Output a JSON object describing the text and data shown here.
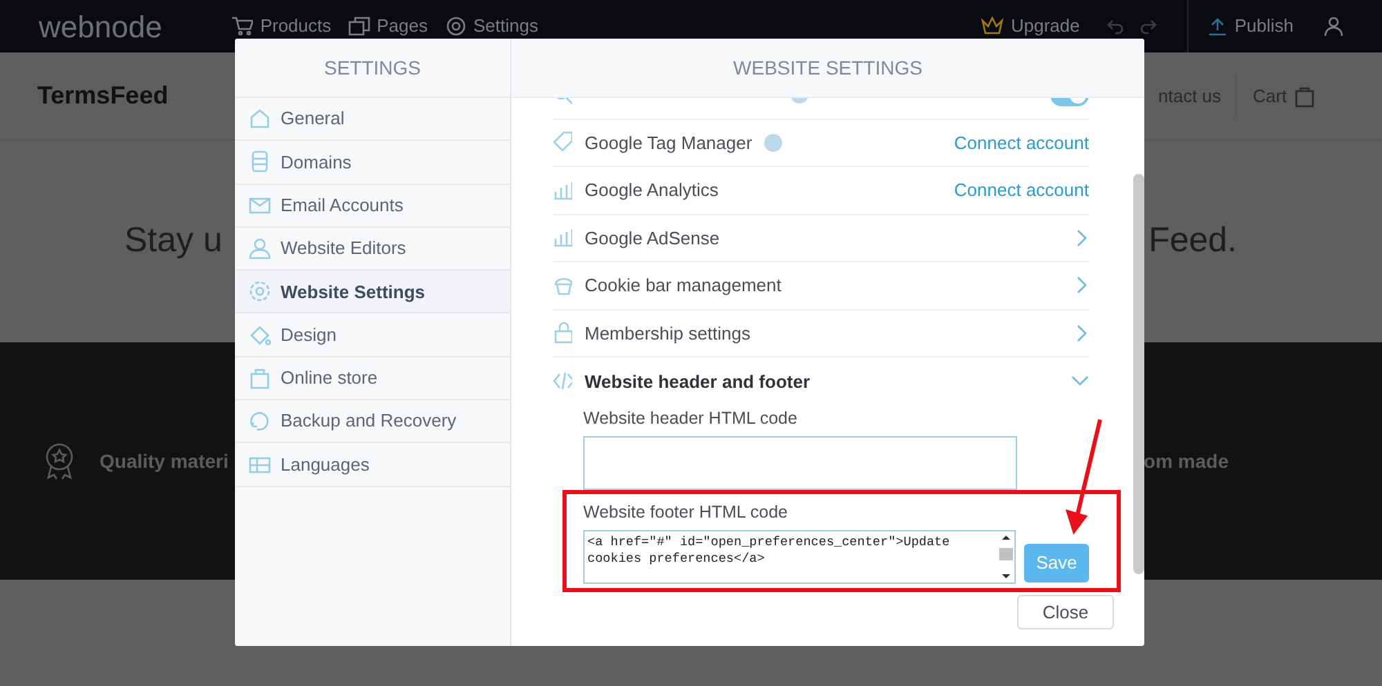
{
  "topbar": {
    "logo": "webnode",
    "nav": [
      {
        "label": "Products"
      },
      {
        "label": "Pages"
      },
      {
        "label": "Settings"
      }
    ],
    "upgrade": "Upgrade",
    "publish": "Publish"
  },
  "site": {
    "brand": "TermsFeed",
    "nav": [
      "ntact us",
      "Cart"
    ],
    "headline_left": "Stay u",
    "headline_right": "Feed.",
    "features": [
      "Quality materi",
      "om made"
    ]
  },
  "modal": {
    "sidebar_title": "SETTINGS",
    "content_title": "WEBSITE SETTINGS",
    "sidebar_items": [
      {
        "label": "General",
        "selected": false
      },
      {
        "label": "Domains",
        "selected": false
      },
      {
        "label": "Email Accounts",
        "selected": false
      },
      {
        "label": "Website Editors",
        "selected": false
      },
      {
        "label": "Website Settings",
        "selected": true
      },
      {
        "label": "Design",
        "selected": false
      },
      {
        "label": "Online store",
        "selected": false
      },
      {
        "label": "Backup and Recovery",
        "selected": false
      },
      {
        "label": "Languages",
        "selected": false
      }
    ],
    "rows": [
      {
        "kind": "toggle",
        "help": true,
        "on": true
      },
      {
        "kind": "link",
        "label": "Google Tag Manager",
        "help": true,
        "action": "Connect account"
      },
      {
        "kind": "link",
        "label": "Google Analytics",
        "help": false,
        "action": "Connect account"
      },
      {
        "kind": "chevron",
        "label": "Google AdSense"
      },
      {
        "kind": "chevron",
        "label": "Cookie bar management"
      },
      {
        "kind": "chevron",
        "label": "Membership settings"
      },
      {
        "kind": "section",
        "label": "Website header and footer",
        "expanded": true
      }
    ],
    "header_code": {
      "label": "Website header HTML code"
    },
    "footer_code": {
      "label": "Website footer HTML code",
      "value": "<a href=\"#\" id=\"open_preferences_center\">Update cookies preferences</a>"
    },
    "save": "Save",
    "close": "Close"
  }
}
